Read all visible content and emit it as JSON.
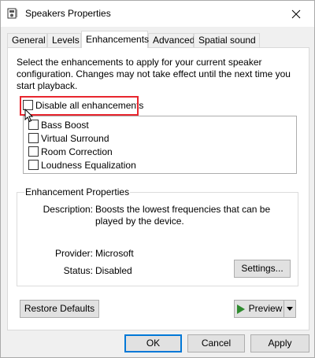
{
  "window": {
    "title": "Speakers Properties"
  },
  "tabs": [
    "General",
    "Levels",
    "Enhancements",
    "Advanced",
    "Spatial sound"
  ],
  "active_tab": "Enhancements",
  "panel": {
    "intro_text": "Select the enhancements to apply for your current speaker configuration. Changes may not take effect until the next time you start playback.",
    "disable_all_label": "Disable all enhancements",
    "enhancements": [
      {
        "label": "Bass Boost",
        "checked": false
      },
      {
        "label": "Virtual Surround",
        "checked": false
      },
      {
        "label": "Room Correction",
        "checked": false
      },
      {
        "label": "Loudness Equalization",
        "checked": false
      }
    ],
    "properties": {
      "group_title": "Enhancement Properties",
      "description_label": "Description:",
      "description_value": "Boosts the lowest frequencies that can be played by the device.",
      "provider_label": "Provider:",
      "provider_value": "Microsoft",
      "status_label": "Status:",
      "status_value": "Disabled",
      "settings_button": "Settings..."
    },
    "restore_defaults_button": "Restore Defaults",
    "preview_button": "Preview"
  },
  "footer": {
    "ok_button": "OK",
    "cancel_button": "Cancel",
    "apply_button": "Apply"
  },
  "colors": {
    "highlight": "#e8262e",
    "accent": "#0078d7",
    "play_icon": "#2e8b2e"
  },
  "icons": {
    "title": "speaker-icon",
    "close": "close-icon",
    "preview": "play-icon",
    "dropdown": "chevron-down-icon",
    "cursor": "mouse-pointer-icon"
  }
}
